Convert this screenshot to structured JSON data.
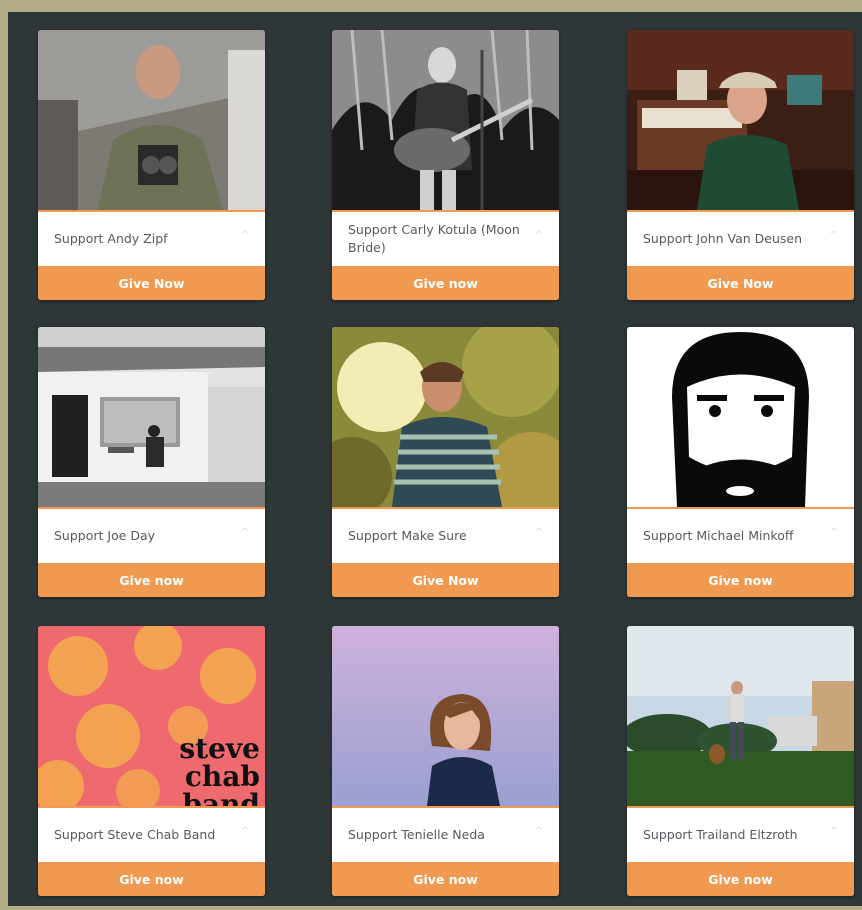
{
  "chevron_glyph": "^",
  "cards": [
    {
      "name": "Support Andy Zipf",
      "button": "Give Now",
      "icon": "photo-andy-zipf"
    },
    {
      "name": "Support Carly Kotula (Moon Bride)",
      "button": "Give now",
      "icon": "photo-carly-kotula"
    },
    {
      "name": "Support John Van Deusen",
      "button": "Give Now",
      "icon": "photo-john-van-deusen"
    },
    {
      "name": "Support Joe Day",
      "button": "Give now",
      "icon": "photo-joe-day"
    },
    {
      "name": "Support Make Sure",
      "button": "Give Now",
      "icon": "photo-make-sure"
    },
    {
      "name": "Support Michael Minkoff",
      "button": "Give now",
      "icon": "photo-michael-minkoff"
    },
    {
      "name": "Support Steve Chab Band",
      "button": "Give now",
      "icon": "photo-steve-chab-band",
      "artwork_text": [
        "steve",
        "chab",
        "band"
      ]
    },
    {
      "name": "Support Tenielle Neda",
      "button": "Give now",
      "icon": "photo-tenielle-neda"
    },
    {
      "name": "Support Trailand Eltzroth",
      "button": "Give now",
      "icon": "photo-trailand-eltzroth"
    }
  ],
  "colors": {
    "accent": "#ef9a50",
    "panel": "#2e3638",
    "outer_border": "#b3ad87",
    "card_text": "#555a5e"
  }
}
